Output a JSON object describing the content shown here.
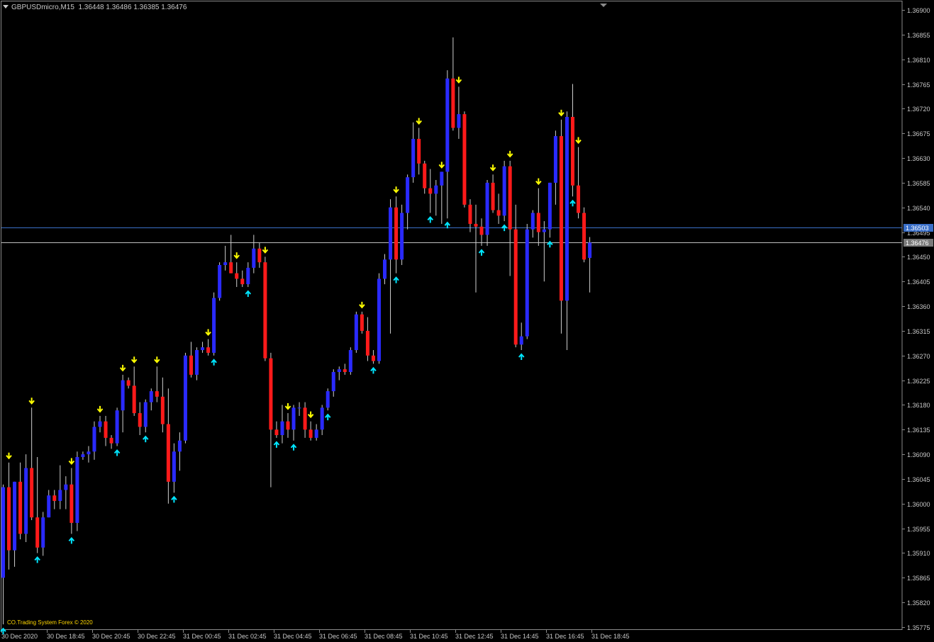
{
  "header": {
    "symbol_timeframe": "GBPUSDmicro,M15",
    "ohlc": "1.36448 1.36486 1.36385 1.36476"
  },
  "watermark": "CO.Trading System Forex  ©  2020",
  "colors": {
    "background": "#000000",
    "bull": "#2a2aff",
    "bear": "#ff1a1a",
    "wick": "#cfcfcf",
    "sell_arrow": "#ffff00",
    "buy_arrow": "#00e5ff",
    "grid_text": "#c8c8c8",
    "ask_line": "#3a6fc8",
    "bid_line": "#c0c0c0"
  },
  "icons": {
    "sell_signal": "yellow-down-arrow-icon",
    "buy_signal": "cyan-up-arrow-icon",
    "dropdown": "triangle-down-icon"
  },
  "chart_data": {
    "type": "candlestick",
    "ylim": [
      1.35775,
      1.369
    ],
    "price_ticks": [
      "1.36900",
      "1.36855",
      "1.36810",
      "1.36765",
      "1.36720",
      "1.36675",
      "1.36630",
      "1.36585",
      "1.36540",
      "1.36495",
      "1.36450",
      "1.36405",
      "1.36360",
      "1.36315",
      "1.36270",
      "1.36225",
      "1.36180",
      "1.36135",
      "1.36090",
      "1.36045",
      "1.36000",
      "1.35955",
      "1.35910",
      "1.35865",
      "1.35820",
      "1.35775"
    ],
    "time_labels": [
      "30 Dec 2020",
      "30 Dec 18:45",
      "30 Dec 20:45",
      "30 Dec 22:45",
      "31 Dec 00:45",
      "31 Dec 02:45",
      "31 Dec 04:45",
      "31 Dec 06:45",
      "31 Dec 08:45",
      "31 Dec 10:45",
      "31 Dec 12:45",
      "31 Dec 14:45",
      "31 Dec 16:45",
      "31 Dec 18:45"
    ],
    "ask_price": "1.36503",
    "bid_price": "1.36476",
    "candles": [
      {
        "o": 1.35865,
        "h": 1.36035,
        "l": 1.3578,
        "c": 1.3603
      },
      {
        "o": 1.3603,
        "h": 1.36075,
        "l": 1.3588,
        "c": 1.35915
      },
      {
        "o": 1.35915,
        "h": 1.3604,
        "l": 1.35885,
        "c": 1.3604
      },
      {
        "o": 1.3604,
        "h": 1.36075,
        "l": 1.35935,
        "c": 1.35945
      },
      {
        "o": 1.35945,
        "h": 1.3609,
        "l": 1.3593,
        "c": 1.36065
      },
      {
        "o": 1.36065,
        "h": 1.36175,
        "l": 1.3597,
        "c": 1.35975
      },
      {
        "o": 1.35975,
        "h": 1.36085,
        "l": 1.3591,
        "c": 1.3592
      },
      {
        "o": 1.3592,
        "h": 1.35985,
        "l": 1.35905,
        "c": 1.35975
      },
      {
        "o": 1.35975,
        "h": 1.36025,
        "l": 1.35975,
        "c": 1.36015
      },
      {
        "o": 1.36015,
        "h": 1.36025,
        "l": 1.3599,
        "c": 1.36005
      },
      {
        "o": 1.36005,
        "h": 1.3607,
        "l": 1.3599,
        "c": 1.36025
      },
      {
        "o": 1.36025,
        "h": 1.3605,
        "l": 1.3599,
        "c": 1.36035
      },
      {
        "o": 1.36035,
        "h": 1.36065,
        "l": 1.35945,
        "c": 1.35965
      },
      {
        "o": 1.35965,
        "h": 1.36095,
        "l": 1.3595,
        "c": 1.36085
      },
      {
        "o": 1.36085,
        "h": 1.36095,
        "l": 1.3608,
        "c": 1.3609
      },
      {
        "o": 1.3609,
        "h": 1.36105,
        "l": 1.36075,
        "c": 1.36095
      },
      {
        "o": 1.36095,
        "h": 1.3615,
        "l": 1.3608,
        "c": 1.3614
      },
      {
        "o": 1.3614,
        "h": 1.3616,
        "l": 1.3613,
        "c": 1.3615
      },
      {
        "o": 1.3615,
        "h": 1.3616,
        "l": 1.36105,
        "c": 1.3612
      },
      {
        "o": 1.3612,
        "h": 1.36125,
        "l": 1.361,
        "c": 1.3611
      },
      {
        "o": 1.3611,
        "h": 1.36175,
        "l": 1.36105,
        "c": 1.3617
      },
      {
        "o": 1.3617,
        "h": 1.36235,
        "l": 1.3613,
        "c": 1.36225
      },
      {
        "o": 1.36225,
        "h": 1.3623,
        "l": 1.3621,
        "c": 1.36215
      },
      {
        "o": 1.36215,
        "h": 1.3625,
        "l": 1.3616,
        "c": 1.36165
      },
      {
        "o": 1.36165,
        "h": 1.36185,
        "l": 1.36125,
        "c": 1.3614
      },
      {
        "o": 1.3614,
        "h": 1.3619,
        "l": 1.3613,
        "c": 1.36185
      },
      {
        "o": 1.36185,
        "h": 1.3621,
        "l": 1.3617,
        "c": 1.36205
      },
      {
        "o": 1.36205,
        "h": 1.3625,
        "l": 1.36185,
        "c": 1.36195
      },
      {
        "o": 1.36195,
        "h": 1.3623,
        "l": 1.3613,
        "c": 1.36145
      },
      {
        "o": 1.36145,
        "h": 1.3621,
        "l": 1.36,
        "c": 1.3604
      },
      {
        "o": 1.3604,
        "h": 1.3611,
        "l": 1.3602,
        "c": 1.36095
      },
      {
        "o": 1.36095,
        "h": 1.3613,
        "l": 1.3606,
        "c": 1.36115
      },
      {
        "o": 1.36115,
        "h": 1.36275,
        "l": 1.3611,
        "c": 1.3627
      },
      {
        "o": 1.3627,
        "h": 1.36295,
        "l": 1.3623,
        "c": 1.36235
      },
      {
        "o": 1.36235,
        "h": 1.36285,
        "l": 1.36225,
        "c": 1.3628
      },
      {
        "o": 1.3628,
        "h": 1.36295,
        "l": 1.36275,
        "c": 1.36285
      },
      {
        "o": 1.36285,
        "h": 1.363,
        "l": 1.3627,
        "c": 1.36275
      },
      {
        "o": 1.36275,
        "h": 1.36385,
        "l": 1.3627,
        "c": 1.36375
      },
      {
        "o": 1.36375,
        "h": 1.3644,
        "l": 1.3637,
        "c": 1.36435
      },
      {
        "o": 1.36435,
        "h": 1.3647,
        "l": 1.36425,
        "c": 1.3644
      },
      {
        "o": 1.3644,
        "h": 1.3649,
        "l": 1.3642,
        "c": 1.3642
      },
      {
        "o": 1.3642,
        "h": 1.3644,
        "l": 1.36395,
        "c": 1.3641
      },
      {
        "o": 1.3641,
        "h": 1.36425,
        "l": 1.36395,
        "c": 1.364
      },
      {
        "o": 1.364,
        "h": 1.3644,
        "l": 1.36395,
        "c": 1.3643
      },
      {
        "o": 1.3643,
        "h": 1.3649,
        "l": 1.3642,
        "c": 1.36465
      },
      {
        "o": 1.36465,
        "h": 1.36475,
        "l": 1.3643,
        "c": 1.3644
      },
      {
        "o": 1.3644,
        "h": 1.3645,
        "l": 1.3626,
        "c": 1.36265
      },
      {
        "o": 1.36265,
        "h": 1.36275,
        "l": 1.3603,
        "c": 1.36135
      },
      {
        "o": 1.36135,
        "h": 1.3615,
        "l": 1.3612,
        "c": 1.36125
      },
      {
        "o": 1.36125,
        "h": 1.3618,
        "l": 1.3611,
        "c": 1.3615
      },
      {
        "o": 1.3615,
        "h": 1.36165,
        "l": 1.3612,
        "c": 1.36135
      },
      {
        "o": 1.36135,
        "h": 1.3618,
        "l": 1.36115,
        "c": 1.36175
      },
      {
        "o": 1.36175,
        "h": 1.36185,
        "l": 1.3616,
        "c": 1.36175
      },
      {
        "o": 1.36175,
        "h": 1.36185,
        "l": 1.3612,
        "c": 1.36135
      },
      {
        "o": 1.36135,
        "h": 1.3615,
        "l": 1.36115,
        "c": 1.3612
      },
      {
        "o": 1.3612,
        "h": 1.36145,
        "l": 1.36115,
        "c": 1.36135
      },
      {
        "o": 1.36135,
        "h": 1.3618,
        "l": 1.36125,
        "c": 1.36175
      },
      {
        "o": 1.36175,
        "h": 1.3621,
        "l": 1.3617,
        "c": 1.36205
      },
      {
        "o": 1.36205,
        "h": 1.36245,
        "l": 1.36195,
        "c": 1.3624
      },
      {
        "o": 1.3624,
        "h": 1.3625,
        "l": 1.36225,
        "c": 1.36245
      },
      {
        "o": 1.36245,
        "h": 1.36255,
        "l": 1.36235,
        "c": 1.3624
      },
      {
        "o": 1.3624,
        "h": 1.36285,
        "l": 1.36235,
        "c": 1.3628
      },
      {
        "o": 1.3628,
        "h": 1.3635,
        "l": 1.36275,
        "c": 1.36345
      },
      {
        "o": 1.36345,
        "h": 1.3635,
        "l": 1.3631,
        "c": 1.36315
      },
      {
        "o": 1.36315,
        "h": 1.3634,
        "l": 1.3626,
        "c": 1.3627
      },
      {
        "o": 1.3627,
        "h": 1.3628,
        "l": 1.36255,
        "c": 1.3626
      },
      {
        "o": 1.3626,
        "h": 1.3642,
        "l": 1.36255,
        "c": 1.3641
      },
      {
        "o": 1.3641,
        "h": 1.36455,
        "l": 1.364,
        "c": 1.36445
      },
      {
        "o": 1.36445,
        "h": 1.36555,
        "l": 1.3631,
        "c": 1.3654
      },
      {
        "o": 1.3654,
        "h": 1.3656,
        "l": 1.3642,
        "c": 1.36445
      },
      {
        "o": 1.36445,
        "h": 1.36545,
        "l": 1.36435,
        "c": 1.3653
      },
      {
        "o": 1.3653,
        "h": 1.366,
        "l": 1.365,
        "c": 1.36595
      },
      {
        "o": 1.36595,
        "h": 1.36695,
        "l": 1.36585,
        "c": 1.36665
      },
      {
        "o": 1.36665,
        "h": 1.36685,
        "l": 1.366,
        "c": 1.3662
      },
      {
        "o": 1.3662,
        "h": 1.36625,
        "l": 1.36565,
        "c": 1.36575
      },
      {
        "o": 1.36575,
        "h": 1.3661,
        "l": 1.3653,
        "c": 1.36565
      },
      {
        "o": 1.36565,
        "h": 1.3659,
        "l": 1.36525,
        "c": 1.3658
      },
      {
        "o": 1.3658,
        "h": 1.36605,
        "l": 1.3651,
        "c": 1.36605
      },
      {
        "o": 1.36605,
        "h": 1.3679,
        "l": 1.3652,
        "c": 1.36775
      },
      {
        "o": 1.36775,
        "h": 1.3685,
        "l": 1.3668,
        "c": 1.36685
      },
      {
        "o": 1.36685,
        "h": 1.3676,
        "l": 1.36665,
        "c": 1.3671
      },
      {
        "o": 1.3671,
        "h": 1.36715,
        "l": 1.3654,
        "c": 1.36545
      },
      {
        "o": 1.36545,
        "h": 1.36555,
        "l": 1.36495,
        "c": 1.3651
      },
      {
        "o": 1.3651,
        "h": 1.36545,
        "l": 1.36385,
        "c": 1.36505
      },
      {
        "o": 1.36505,
        "h": 1.3652,
        "l": 1.3647,
        "c": 1.3649
      },
      {
        "o": 1.3649,
        "h": 1.3659,
        "l": 1.3647,
        "c": 1.36585
      },
      {
        "o": 1.36585,
        "h": 1.366,
        "l": 1.3653,
        "c": 1.36535
      },
      {
        "o": 1.36535,
        "h": 1.36565,
        "l": 1.3651,
        "c": 1.36525
      },
      {
        "o": 1.36525,
        "h": 1.36625,
        "l": 1.36515,
        "c": 1.36615
      },
      {
        "o": 1.36615,
        "h": 1.36625,
        "l": 1.36415,
        "c": 1.365
      },
      {
        "o": 1.365,
        "h": 1.36545,
        "l": 1.36285,
        "c": 1.3629
      },
      {
        "o": 1.3629,
        "h": 1.3633,
        "l": 1.3628,
        "c": 1.36305
      },
      {
        "o": 1.36305,
        "h": 1.3651,
        "l": 1.363,
        "c": 1.365
      },
      {
        "o": 1.365,
        "h": 1.36535,
        "l": 1.36485,
        "c": 1.3653
      },
      {
        "o": 1.3653,
        "h": 1.36575,
        "l": 1.3647,
        "c": 1.36495
      },
      {
        "o": 1.36495,
        "h": 1.36515,
        "l": 1.36405,
        "c": 1.365
      },
      {
        "o": 1.365,
        "h": 1.36585,
        "l": 1.36485,
        "c": 1.36585
      },
      {
        "o": 1.36585,
        "h": 1.3668,
        "l": 1.36545,
        "c": 1.3667
      },
      {
        "o": 1.3667,
        "h": 1.367,
        "l": 1.3631,
        "c": 1.3637
      },
      {
        "o": 1.3637,
        "h": 1.36715,
        "l": 1.3628,
        "c": 1.36705
      },
      {
        "o": 1.36705,
        "h": 1.36765,
        "l": 1.3656,
        "c": 1.3658
      },
      {
        "o": 1.3658,
        "h": 1.3665,
        "l": 1.3652,
        "c": 1.3653
      },
      {
        "o": 1.3653,
        "h": 1.3654,
        "l": 1.3644,
        "c": 1.36445
      },
      {
        "o": 1.36448,
        "h": 1.36486,
        "l": 1.36385,
        "c": 1.36476
      }
    ],
    "sell_signals": [
      1,
      5,
      12,
      17,
      21,
      23,
      27,
      36,
      41,
      46,
      50,
      54,
      63,
      69,
      73,
      77,
      80,
      86,
      89,
      94,
      98,
      101
    ],
    "buy_signals": [
      0,
      6,
      12,
      20,
      25,
      30,
      37,
      43,
      48,
      51,
      57,
      65,
      69,
      75,
      78,
      84,
      88,
      91,
      96,
      100
    ]
  }
}
